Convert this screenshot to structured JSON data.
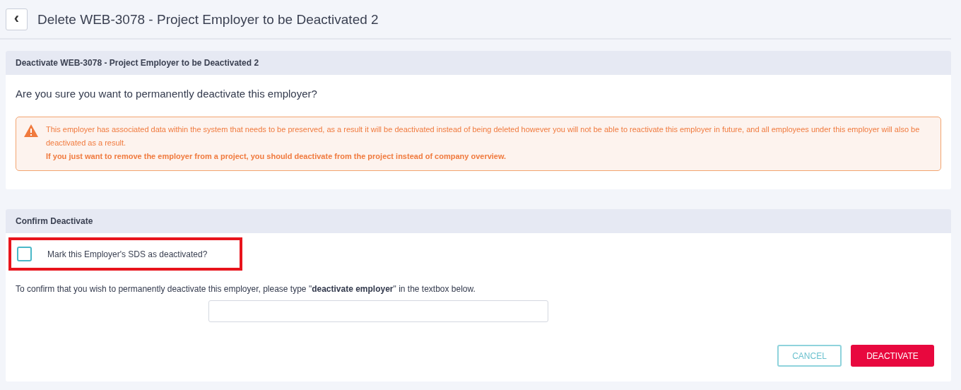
{
  "header": {
    "back_icon": "‹",
    "title": "Delete WEB-3078 - Project Employer to be Deactivated 2"
  },
  "deactivate_panel": {
    "title": "Deactivate WEB-3078 - Project Employer to be Deactivated 2",
    "question": "Are you sure you want to permanently deactivate this employer?",
    "warning": {
      "text": "This employer has associated data within the system that needs to be preserved, as a result it will be deactivated instead of being deleted however you will not be able to reactivate this employer in future, and all employees under this employer will also be deactivated as a result.",
      "emphasis": "If you just want to remove the employer from a project, you should deactivate from the project instead of company overview."
    }
  },
  "confirm_panel": {
    "title": "Confirm Deactivate",
    "checkbox": {
      "label": "Mark this Employer's SDS as deactivated?",
      "checked": false,
      "highlighted": true
    },
    "instruction": "To confirm that you wish to permanently deactivate this employer, please type \"**deactivate employer**\" in the textbox below.",
    "buttons": [
      {
        "label": "CANCEL",
        "kind": "secondary"
      },
      {
        "label": "DEACTIVATE",
        "kind": "danger"
      }
    ]
  }
}
